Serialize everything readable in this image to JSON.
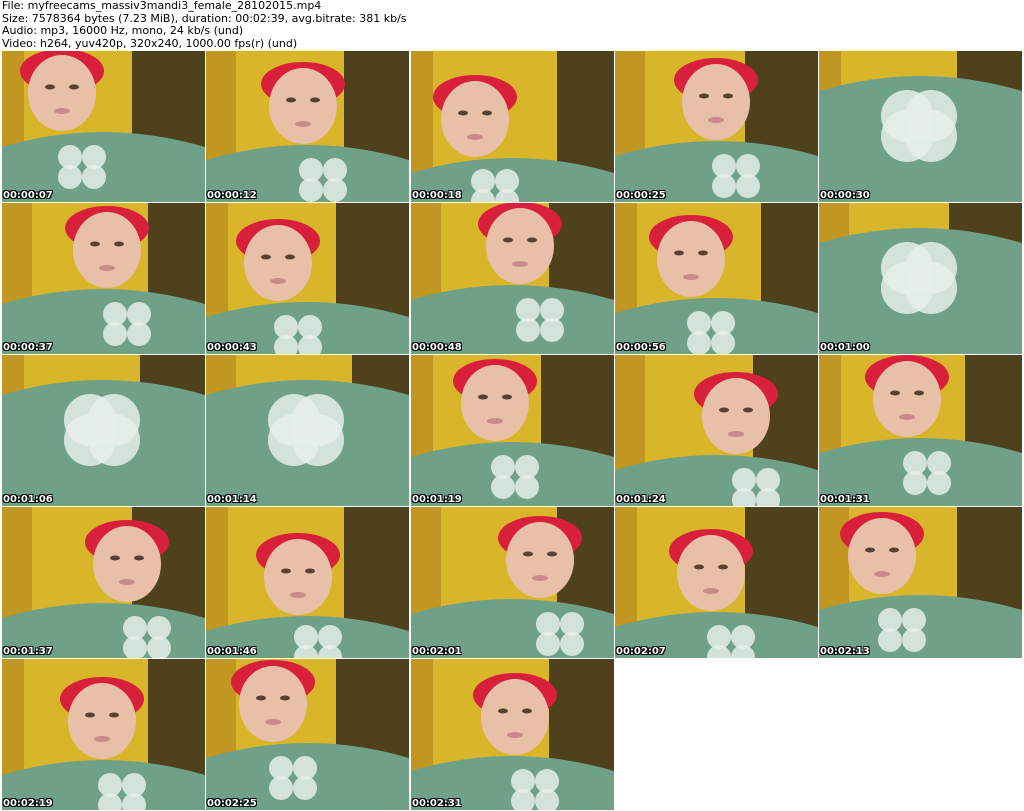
{
  "header": {
    "file_line": "File: myfreecams_massiv3mandi3_female_28102015.mp4",
    "size_line": "Size: 7578364 bytes (7.23 MiB), duration: 00:02:39, avg.bitrate: 381 kb/s",
    "audio_line": "Audio: mp3, 16000 Hz, mono, 24 kb/s (und)",
    "video_line": "Video: h264, yuv420p, 320x240, 1000.00 fps(r) (und)"
  },
  "thumbnails": [
    {
      "timestamp": "00:00:07"
    },
    {
      "timestamp": "00:00:12"
    },
    {
      "timestamp": "00:00:18"
    },
    {
      "timestamp": "00:00:25"
    },
    {
      "timestamp": "00:00:30"
    },
    {
      "timestamp": "00:00:37"
    },
    {
      "timestamp": "00:00:43"
    },
    {
      "timestamp": "00:00:48"
    },
    {
      "timestamp": "00:00:56"
    },
    {
      "timestamp": "00:01:00"
    },
    {
      "timestamp": "00:01:06"
    },
    {
      "timestamp": "00:01:14"
    },
    {
      "timestamp": "00:01:19"
    },
    {
      "timestamp": "00:01:24"
    },
    {
      "timestamp": "00:01:31"
    },
    {
      "timestamp": "00:01:37"
    },
    {
      "timestamp": "00:01:46"
    },
    {
      "timestamp": "00:02:01"
    },
    {
      "timestamp": "00:02:07"
    },
    {
      "timestamp": "00:02:13"
    },
    {
      "timestamp": "00:02:19"
    },
    {
      "timestamp": "00:02:25"
    },
    {
      "timestamp": "00:02:31"
    }
  ],
  "colors": {
    "shirt": "#6fa088",
    "skin": "#e8c0a8",
    "hair": "#d8203a",
    "backdrop_yellow": "#d9b52a",
    "backdrop_dark": "#2a2418",
    "timestamp_text": "#ffffff"
  }
}
